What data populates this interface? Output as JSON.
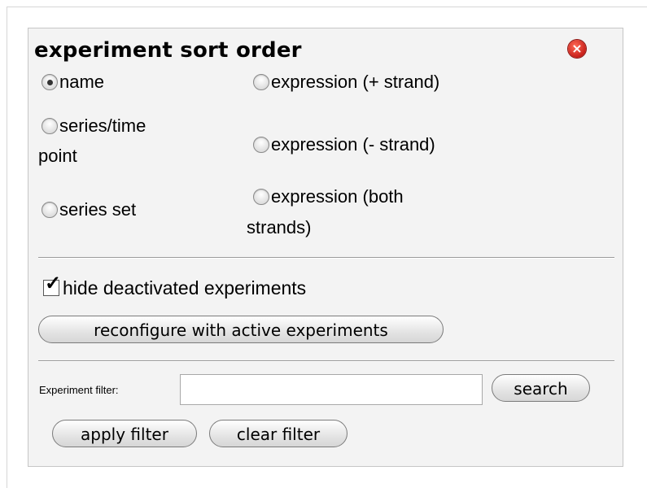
{
  "panel": {
    "title": "experiment sort order",
    "close_icon": "close-icon (red circle with x)"
  },
  "sort_options": [
    {
      "label": "name",
      "checked": true
    },
    {
      "label": "expression (+ strand)",
      "checked": false
    },
    {
      "label_line1": "series/time",
      "label_line2": "point",
      "checked": false
    },
    {
      "label": "expression (- strand)",
      "checked": false
    },
    {
      "label": "series set",
      "checked": false
    },
    {
      "label_line1": "expression (both",
      "label_line2": "strands)",
      "checked": false
    }
  ],
  "hide_deactivated": {
    "label": "hide deactivated experiments",
    "checked": true,
    "check_glyph": "✓"
  },
  "buttons": {
    "reconfigure": "reconfigure with active experiments",
    "search": "search",
    "apply_filter": "apply filter",
    "clear_filter": "clear filter"
  },
  "filter": {
    "label": "Experiment filter:",
    "value": "",
    "placeholder": ""
  },
  "colors": {
    "panel_background": "#f3f3f3",
    "close_button": "#c8201a"
  }
}
